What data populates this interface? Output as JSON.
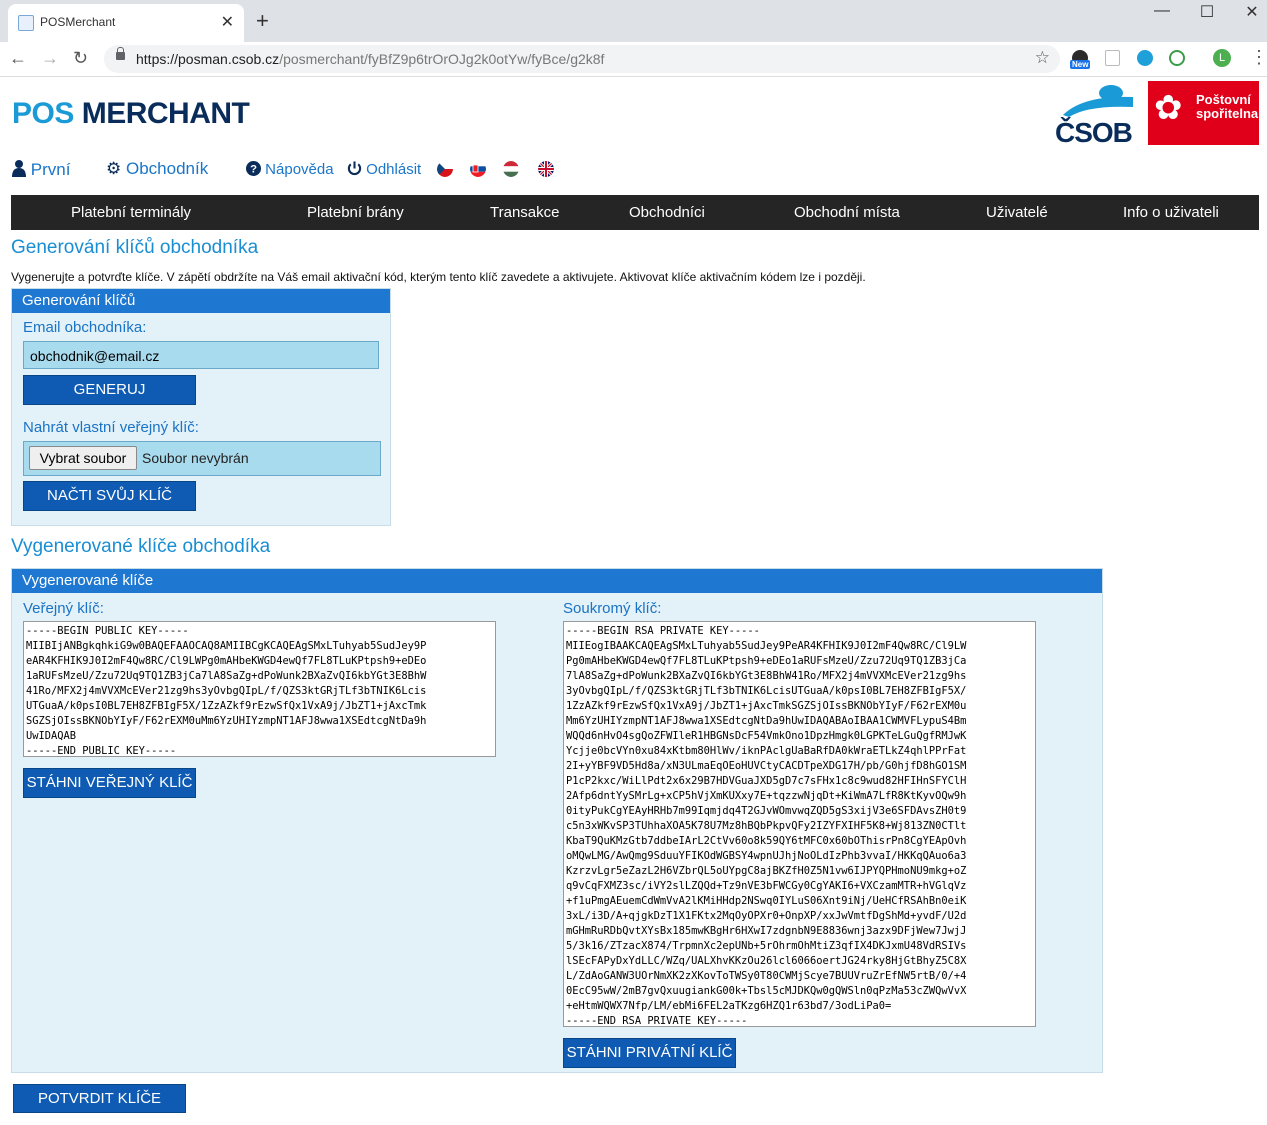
{
  "browser": {
    "tab_title": "POSMerchant",
    "tab_close": "✕",
    "new_tab": "+",
    "url_host": "https://posman.csob.cz",
    "url_path": "/posmerchant/fyBfZ9p6trOrOJg2k0otYw/fyBce/g2k8f",
    "star": "☆",
    "back": "←",
    "forward": "→",
    "reload": "↻",
    "minimize": "—",
    "maximize": "☐",
    "close": "✕",
    "ext_badge": "New",
    "profile_initial": "L",
    "menu": "⋮"
  },
  "brand": {
    "logo_part1": "POS",
    "logo_part2": "MERCHANT",
    "csob": "ČSOB",
    "ps_line1": "Poštovní",
    "ps_line2": "spořitelna"
  },
  "top_menu": {
    "first": "První",
    "merchant": "Obchodník",
    "help": "Nápověda",
    "logout": "Odhlásit"
  },
  "main_nav": [
    "Platební terminály",
    "Platební brány",
    "Transakce",
    "Obchodníci",
    "Obchodní místa",
    "Uživatelé",
    "Info o uživateli"
  ],
  "section1": {
    "title": "Generování klíčů obchodníka",
    "description": "Vygenerujte a potvrďte klíče. V zápětí obdržíte na Váš email aktivační kód, kterým tento klíč zavedete a aktivujete. Aktivovat klíče aktivačním kódem lze i později.",
    "panel_title": "Generování klíčů",
    "email_label": "Email obchodníka:",
    "email_value": "obchodnik@email.cz",
    "generate_button": "GENERUJ",
    "upload_label": "Nahrát vlastní veřejný klíč:",
    "choose_file": "Vybrat soubor",
    "no_file": "Soubor nevybrán",
    "load_key_button": "NAČTI SVŮJ KLÍČ"
  },
  "section2": {
    "title": "Vygenerované klíče obchodíka",
    "panel_title": "Vygenerované klíče",
    "public_label": "Veřejný klíč:",
    "public_key": "-----BEGIN PUBLIC KEY-----\nMIIBIjANBgkqhkiG9w0BAQEFAAOCAQ8AMIIBCgKCAQEAgSMxLTuhyab5SudJey9P\neAR4KFHIK9J0I2mF4Qw8RC/Cl9LWPg0mAHbeKWGD4ewQf7FL8TLuKPtpsh9+eDEo\n1aRUFsMzeU/Zzu72Uq9TQ1ZB3jCa7lA8SaZg+dPoWunk2BXaZvQI6kbYGt3E8BhW\n41Ro/MFX2j4mVVXMcEVer21zg9hs3yOvbgQIpL/f/QZS3ktGRjTLf3bTNIK6Lcis\nUTGuaA/k0psI0BL7EH8ZFBIgF5X/1ZzAZkf9rEzwSfQx1VxA9j/JbZT1+jAxcTmk\nSGZSjOIssBKNObYIyF/F62rEXM0uMm6YzUHIYzmpNT1AFJ8wwa1XSEdtcgNtDa9h\nUwIDAQAB\n-----END PUBLIC KEY-----",
    "download_public_button": "STÁHNI VEŘEJNÝ KLÍČ",
    "private_label": "Soukromý klíč:",
    "private_key": "-----BEGIN RSA PRIVATE KEY-----\nMIIEogIBAAKCAQEAgSMxLTuhyab5SudJey9PeAR4KFHIK9J0I2mF4Qw8RC/Cl9LW\nPg0mAHbeKWGD4ewQf7FL8TLuKPtpsh9+eDEo1aRUFsMzeU/Zzu72Uq9TQ1ZB3jCa\n7lA8SaZg+dPoWunk2BXaZvQI6kbYGt3E8BhW41Ro/MFX2j4mVVXMcEVer21zg9hs\n3yOvbgQIpL/f/QZS3ktGRjTLf3bTNIK6LcisUTGuaA/k0psI0BL7EH8ZFBIgF5X/\n1ZzAZkf9rEzwSfQx1VxA9j/JbZT1+jAxcTmkSGZSjOIssBKNObYIyF/F62rEXM0u\nMm6YzUHIYzmpNT1AFJ8wwa1XSEdtcgNtDa9hUwIDAQABAoIBAA1CWMVFLypuS4Bm\nWQQd6nHvO4sgQoZFWIleR1HBGNsDcF54VmkOno1DpzHmgk0LGPKTeLGuQgfRMJwK\nYcjje0bcVYn0xu84xKtbm80HlWv/iknPAclgUaBaRfDA0kWraETLkZ4qhlPPrFat\n2I+yYBF9VD5Hd8a/xN3ULmaEqOEoHUVCtyCACDTpeXDG17H/pb/G0hjfD8hGO1SM\nP1cP2kxc/WiLlPdt2x6x29B7HDVGuaJXD5gD7c7sFHx1c8c9wud82HFIHnSFYClH\n2Afp6dntYySMrLg+xCP5hVjXmKUXxy7E+tqzzwNjqDt+KiWmA7LfR8KtKyvOQw9h\n0ityPukCgYEAyHRHb7m99Iqmjdq4T2GJvWOmvwqZQD5gS3xijV3e6SFDAvsZH0t9\nc5n3xWKvSP3TUhhaXOA5K78U7Mz8hBQbPkpvQFy2IZYFXIHF5K8+Wj813ZN0CTlt\nKbaT9QuKMzGtb7ddbeIArL2CtVv60o8k59QY6tMFC0x60bOThisrPn8CgYEApOvh\noMQwLMG/AwQmg9SduuYFIKOdWGBSY4wpnUJhjNoOLdIzPhb3vvaI/HKKqQAuo6a3\nKzrzvLgr5eZazL2H6VZbrQL5oUYpgC8ajBKZfH0Z5N1vw6IJPYQPHmoNU9mkg+oZ\nq9vCqFXMZ3sc/iVY2slLZQQd+Tz9nVE3bFWCGy0CgYAKI6+VXCzamMTR+hVGlqVz\n+f1uPmgAEuemCdWmVvA2lKMiHHdp2NSwq0IYLuS06Xnt9iNj/UeHCfRSAhBn0eiK\n3xL/i3D/A+qjgkDzT1X1FKtx2MqOyOPXr0+OnpXP/xxJwVmtfDgShMd+yvdF/U2d\nmGHmRuRDbQvtXYsBx185mwKBgHr6HXwI7zdgnbN9E8836wnj3azx9DFjWew7JwjJ\n5/3k16/ZTzacX874/TrpmnXc2epUNb+5rOhrmOhMtiZ3qfIX4DKJxmU48VdRSIVs\nlSEcFAPyDxYdLLC/WZq/UALXhvKKzOu26lcl6066oertJG24rky8HjGtBhyZ5C8X\nL/ZdAoGANW3UOrNmXK2zXKovToTWSy0T80CWMjScye7BUUVruZrEfNW5rtB/0/+4\n0EcC95wW/2mB7gvQxuugiankG00k+Tbsl5cMJDKQw0gQWSln0qPzMa53cZWQwVvX\n+eHtmWQWX7Nfp/LM/ebMi6FEL2aTKzg6HZQ1r63bd7/3odLiPa0=\n-----END RSA PRIVATE KEY-----",
    "download_private_button": "STÁHNI PRIVÁTNÍ KLÍČ"
  },
  "confirm_button": "POTVRDIT KLÍČE",
  "colors": {
    "accent_blue": "#1a8ed2",
    "button_blue": "#0f5bb3",
    "panel_bg": "#e3f1f8",
    "nav_bg": "#252525",
    "ps_red": "#e1001a"
  }
}
